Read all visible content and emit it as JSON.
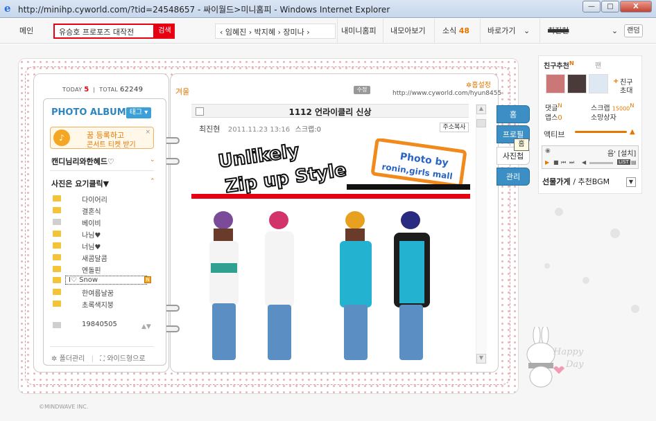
{
  "window": {
    "title": "http://minihp.cyworld.com/?tid=24548657 - 싸이월드>미니홈피 - Windows Internet Explorer",
    "min": "—",
    "max": "□",
    "close": "X"
  },
  "nav": {
    "main": "메인",
    "search_value": "유승호 프로포즈 대작전",
    "search_btn": "검색",
    "history": "‹  임혜진 › 박지혜 › 장미나  ›",
    "my_homepy": "내미니홈피",
    "collection": "내모아보기",
    "news": "소식",
    "news_count": "48",
    "shortcut": "바로가기",
    "user": "최진현",
    "random": "랜덤"
  },
  "counter": {
    "today_label": "TODAY",
    "today": "5",
    "total_label": "TOTAL",
    "total": "62249"
  },
  "album": {
    "title": "PHOTO ALBUM",
    "tag_btn": "태그",
    "promo_line1": "꿈 등록하고",
    "promo_line2": "콘서트 티켓 받기",
    "promo_close": "×",
    "group1": "캔디님리와한혜드♡",
    "group2": "사진은 요기클릭▼",
    "folders": [
      {
        "label": "다이어리",
        "gray": false
      },
      {
        "label": "결혼식",
        "gray": false
      },
      {
        "label": "베이비",
        "gray": true
      },
      {
        "label": "나님♥",
        "gray": false
      },
      {
        "label": "너님♥",
        "gray": false
      },
      {
        "label": "새콤달콤",
        "gray": false
      },
      {
        "label": "엔돌핀",
        "gray": false
      },
      {
        "label": "I♡ Snow",
        "gray": false,
        "selected": true,
        "new": "N"
      },
      {
        "label": "한여름날꿈",
        "gray": false
      },
      {
        "label": "초록색지붕",
        "gray": false
      },
      {
        "label": "19840505",
        "gray": true
      }
    ],
    "folder_manage": "폴더관리",
    "wide_view": "와이드형으로"
  },
  "post": {
    "season": "겨울",
    "edit": "수정",
    "home_settings": "홈설정",
    "url": "http://www.cyworld.com/hyun8455",
    "title": "1112 언라이클리 신상",
    "author": "최진현",
    "datetime": "2011.11.23 13:16",
    "scrap_label": "스크랩:0",
    "copy_addr": "주소복사",
    "photo_headline1": "Unlikely",
    "photo_headline2": "Zip up Style",
    "photo_tag1": "Photo by",
    "photo_tag2": "ronin,girls mall"
  },
  "tabs": [
    "홈",
    "프로필",
    "사진첩",
    "관리"
  ],
  "tooltip": "홈",
  "right": {
    "friend_rec": "친구추천",
    "fan": "팬",
    "friend_invite1": "친구",
    "friend_invite2": "초대",
    "comment": "댓글",
    "apps": "앱스",
    "apps_count": "0",
    "scrap": "스크랩",
    "scrap_count": "15000",
    "wish": "소망상자",
    "active": "액티브",
    "bgm_label": "음' [설치]",
    "bgm_list": "LIST",
    "gift": "선물가게",
    "bgm_link": "/ 추천BGM"
  },
  "copyright": "©MINDWAVE INC."
}
